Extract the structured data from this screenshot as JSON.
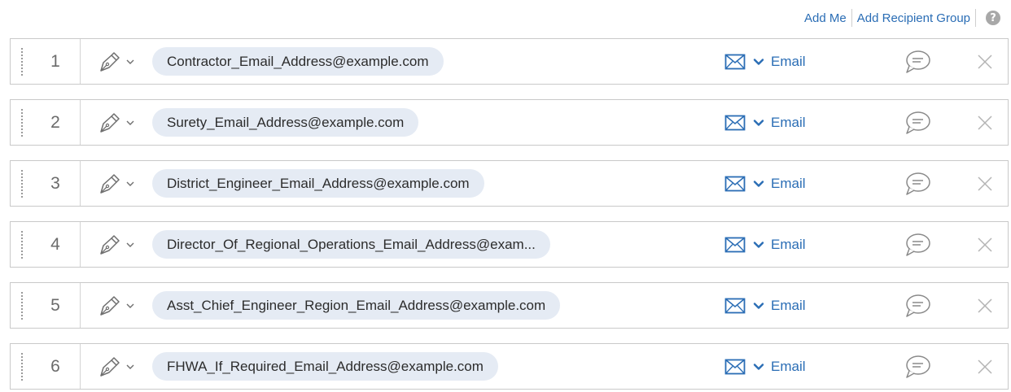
{
  "header": {
    "add_me": "Add Me",
    "add_recipient_group": "Add Recipient Group",
    "help": "?"
  },
  "recipients": [
    {
      "number": "1",
      "email": "Contractor_Email_Address@example.com",
      "delivery": "Email"
    },
    {
      "number": "2",
      "email": "Surety_Email_Address@example.com",
      "delivery": "Email"
    },
    {
      "number": "3",
      "email": "District_Engineer_Email_Address@example.com",
      "delivery": "Email"
    },
    {
      "number": "4",
      "email": "Director_Of_Regional_Operations_Email_Address@exam...",
      "delivery": "Email"
    },
    {
      "number": "5",
      "email": "Asst_Chief_Engineer_Region_Email_Address@example.com",
      "delivery": "Email"
    },
    {
      "number": "6",
      "email": "FHWA_If_Required_Email_Address@example.com",
      "delivery": "Email"
    }
  ],
  "colors": {
    "link": "#2a6db5",
    "pill": "#e5ebf4",
    "border": "#c9c9c9"
  }
}
